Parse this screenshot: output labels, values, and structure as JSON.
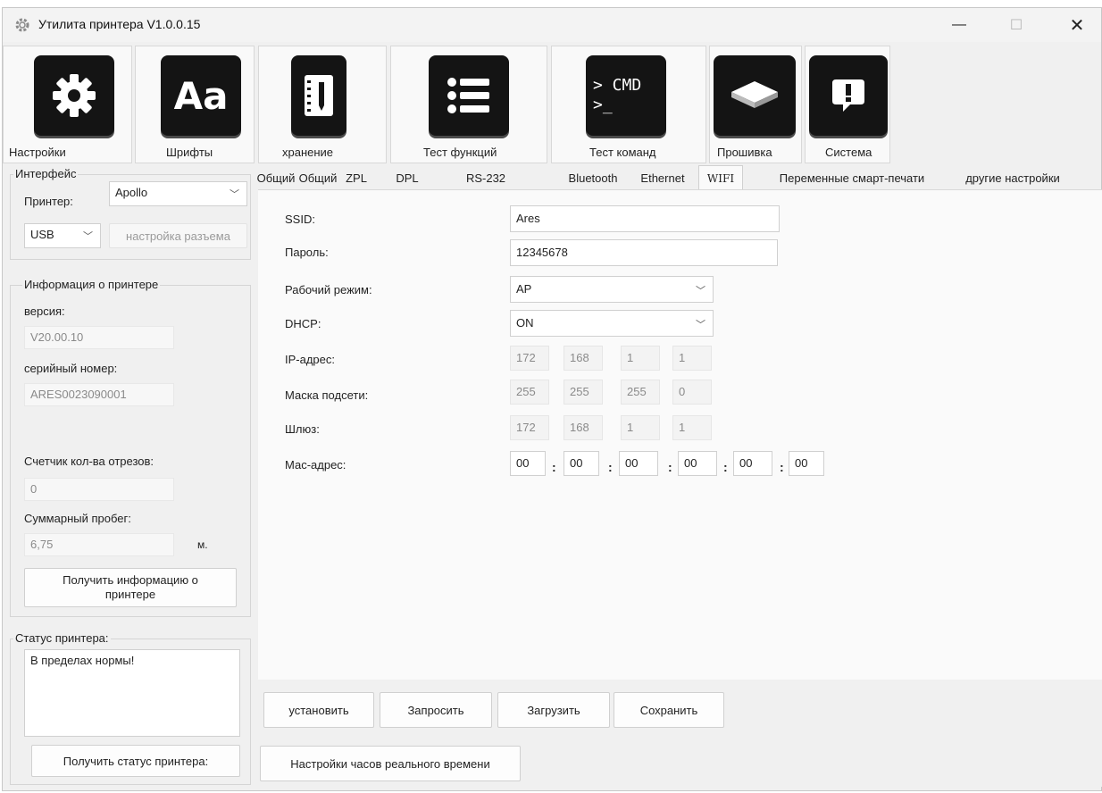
{
  "window": {
    "title": "Утилита принтера  V1.0.0.15"
  },
  "toolbar": {
    "settings": "Настройки",
    "fonts": "Шрифты",
    "fonts_glyph": "Aa",
    "storage": "хранение",
    "function_test": "Тест функций",
    "command_test": "Тест команд",
    "cmd_glyph_line1": "> CMD",
    "cmd_glyph_line2": ">_",
    "firmware": "Прошивка",
    "system": "Система"
  },
  "interface": {
    "legend": "Интерфейс",
    "printer_label": "Принтер:",
    "printer_value": "Apollo",
    "port_value": "USB",
    "port_settings": "настройка разъема"
  },
  "printer_info": {
    "legend": "Информация о принтере",
    "version_label": "версия:",
    "version_value": "V20.00.10",
    "serial_label": "серийный номер:",
    "serial_value": "ARES0023090001",
    "cut_counter_label": "Счетчик кол-ва отрезов:",
    "cut_counter_value": "0",
    "mileage_label": "Суммарный пробег:",
    "mileage_value": "6,75",
    "mileage_unit": "м.",
    "get_info_button": "Получить информацию о принтере"
  },
  "printer_status": {
    "legend": "Статус принтера:",
    "text": "В пределах нормы!",
    "get_status_button": "Получить статус принтера:"
  },
  "tabs": [
    "Общий",
    "Общий",
    "ZPL",
    "DPL",
    "RS-232",
    "Bluetooth",
    "Ethernet",
    "WIFI",
    "Переменные смарт-печати",
    "другие настройки"
  ],
  "wifi": {
    "ssid_label": "SSID:",
    "ssid_value": "Ares",
    "password_label": "Пароль:",
    "password_value": "12345678",
    "mode_label": "Рабочий режим:",
    "mode_value": "AP",
    "dhcp_label": "DHCP:",
    "dhcp_value": "ON",
    "ip_label": "IP-адрес:",
    "ip": [
      "172",
      "168",
      "1",
      "1"
    ],
    "mask_label": "Маска подсети:",
    "mask": [
      "255",
      "255",
      "255",
      "0"
    ],
    "gateway_label": "Шлюз:",
    "gateway": [
      "172",
      "168",
      "1",
      "1"
    ],
    "mac_label": "Мас-адрес:",
    "mac": [
      "00",
      "00",
      "00",
      "00",
      "00",
      "00"
    ],
    "mac_separator": ":"
  },
  "actions": {
    "set": "установить",
    "query": "Запросить",
    "load": "Загрузить",
    "save": "Сохранить",
    "rtc": "Настройки часов реального времени"
  }
}
